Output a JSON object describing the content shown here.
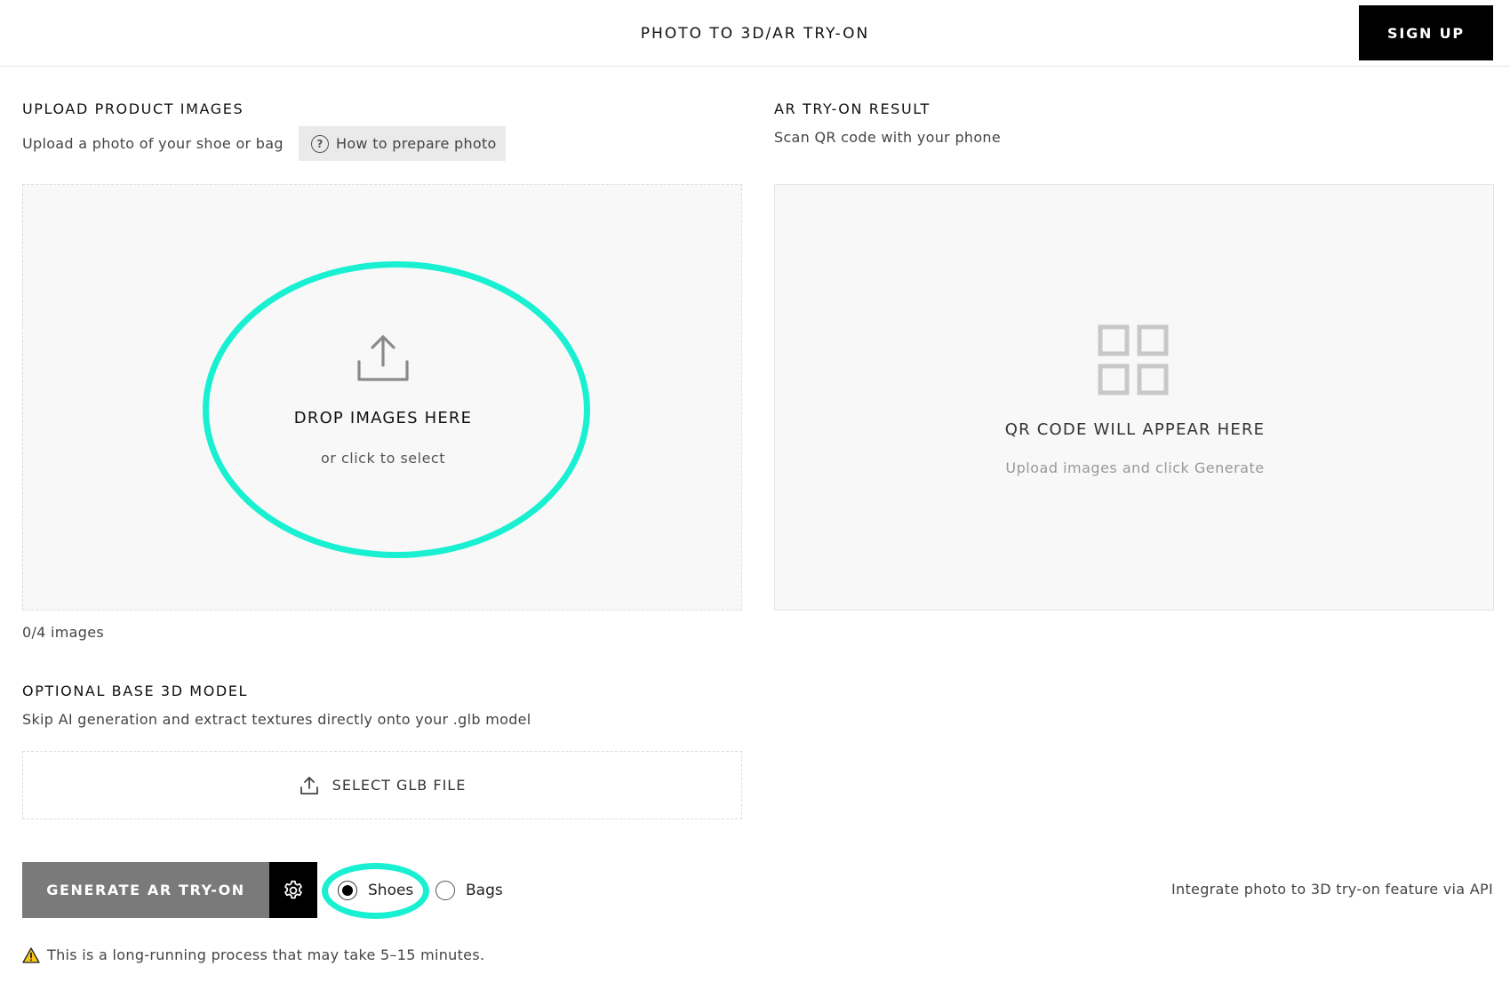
{
  "header": {
    "title": "PHOTO TO 3D/AR TRY-ON",
    "signup_label": "SIGN UP"
  },
  "upload": {
    "heading": "UPLOAD PRODUCT IMAGES",
    "subtitle": "Upload a photo of your shoe or bag",
    "howto_label": "How to prepare photo",
    "drop_title": "DROP IMAGES HERE",
    "drop_sub": "or click to select",
    "count": "0/4 images"
  },
  "result": {
    "heading": "AR TRY-ON RESULT",
    "subtitle": "Scan QR code with your phone",
    "qr_title": "QR CODE WILL APPEAR HERE",
    "qr_sub": "Upload images and click Generate"
  },
  "base_model": {
    "heading": "OPTIONAL BASE 3D MODEL",
    "subtitle": "Skip AI generation and extract textures directly onto your .glb model",
    "select_label": "SELECT GLB FILE"
  },
  "actions": {
    "generate_label": "GENERATE AR TRY-ON",
    "category_options": [
      "Shoes",
      "Bags"
    ],
    "category_selected": "Shoes",
    "api_link": "Integrate photo to 3D try-on feature via API"
  },
  "warning": {
    "text": "This is a long-running process that may take 5–15 minutes."
  },
  "icons": {
    "upload": "upload-icon",
    "help": "question-circle-icon",
    "qr": "qr-placeholder-icon",
    "settings": "gear-icon",
    "warning": "warning-triangle-icon"
  },
  "colors": {
    "accent_highlight": "#19f0d2",
    "primary_dark": "#000000",
    "disabled_button": "#7a7a7a",
    "panel_bg": "#f8f8f8"
  }
}
